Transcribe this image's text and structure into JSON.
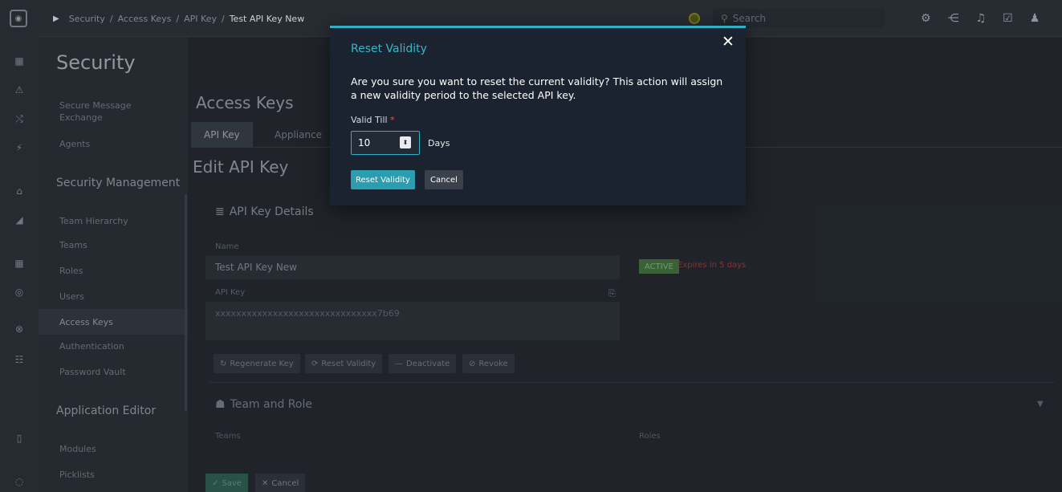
{
  "header": {
    "breadcrumbs": [
      "Security",
      "Access Keys",
      "API Key",
      "Test API Key New"
    ],
    "search_placeholder": "Search"
  },
  "sidebar": {
    "title": "Security",
    "items": [
      {
        "label": "Secure Message Exchange"
      },
      {
        "label": "Agents"
      },
      {
        "group": "Security Management"
      },
      {
        "label": "Team Hierarchy"
      },
      {
        "label": "Teams"
      },
      {
        "label": "Roles"
      },
      {
        "label": "Users"
      },
      {
        "label": "Access Keys",
        "active": true
      },
      {
        "label": "Authentication"
      },
      {
        "label": "Password Vault"
      },
      {
        "group": "Application Editor"
      },
      {
        "label": "Modules"
      },
      {
        "label": "Picklists"
      }
    ]
  },
  "main": {
    "section_title": "Access Keys",
    "tabs": [
      {
        "label": "API Key",
        "active": true
      },
      {
        "label": "Appliance"
      }
    ],
    "page_title": "Edit API Key",
    "details_title": "API Key Details",
    "name_label": "Name",
    "name_value": "Test API Key New",
    "status_badge": "ACTIVE",
    "expires_text": "Expires in 5 days",
    "api_key_label": "API Key",
    "api_key_value": "xxxxxxxxxxxxxxxxxxxxxxxxxxxxxxx7b69",
    "actions": [
      "Regenerate Key",
      "Reset Validity",
      "Deactivate",
      "Revoke"
    ],
    "team_role_title": "Team and Role",
    "teams_header": "Teams",
    "roles_header": "Roles",
    "save_label": "Save",
    "cancel_label": "Cancel"
  },
  "modal": {
    "title": "Reset Validity",
    "message": "Are you sure you want to reset the current validity? This action will assign a new validity period to the selected API key.",
    "field_label": "Valid Till",
    "field_required_mark": "*",
    "field_value": "10",
    "field_unit": "Days",
    "confirm_label": "Reset Validity",
    "cancel_label": "Cancel",
    "accent_color": "#2fb0c4"
  }
}
